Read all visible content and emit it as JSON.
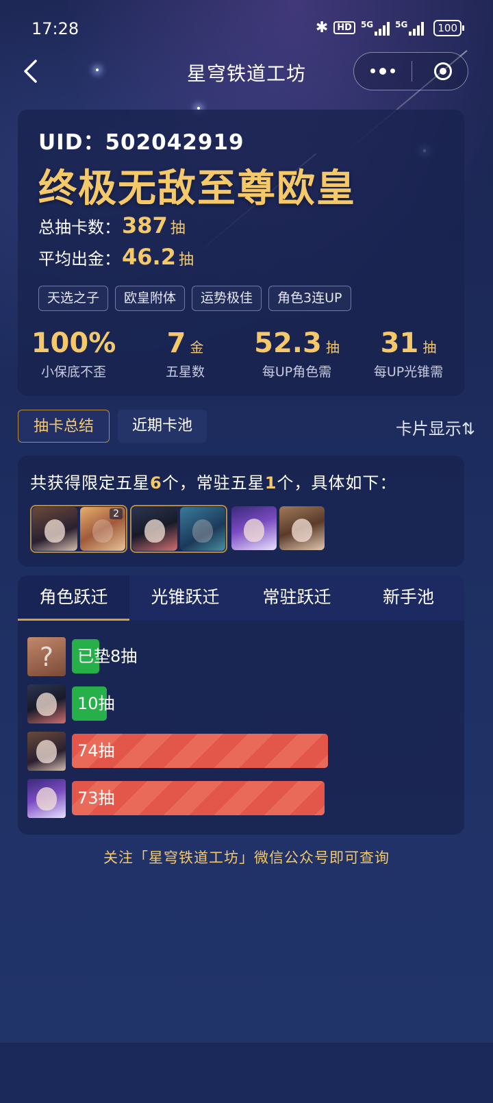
{
  "status_bar": {
    "time": "17:28",
    "hd_label": "HD",
    "network1": "5G",
    "network2": "5G",
    "battery": "100"
  },
  "nav": {
    "title": "星穹铁道工坊"
  },
  "summary": {
    "uid_label": "UID：",
    "uid_value": "502042919",
    "rank_title": "终极无敌至尊欧皇",
    "total_label": "总抽卡数：",
    "total_value": "387",
    "total_unit": "抽",
    "avg_label": "平均出金：",
    "avg_value": "46.2",
    "avg_unit": "抽",
    "tags": [
      "天选之子",
      "欧皇附体",
      "运势极佳",
      "角色3连UP"
    ],
    "metrics": [
      {
        "value": "100%",
        "unit": "",
        "label": "小保底不歪"
      },
      {
        "value": "7",
        "unit": "金",
        "label": "五星数"
      },
      {
        "value": "52.3",
        "unit": "抽",
        "label": "每UP角色需"
      },
      {
        "value": "31",
        "unit": "抽",
        "label": "每UP光锥需"
      }
    ]
  },
  "section_tabs": {
    "summary": "抽卡总结",
    "recent": "近期卡池",
    "display_toggle": "卡片显示⇅"
  },
  "obtained": {
    "prefix": "共获得限定五星",
    "limited_count": "6",
    "middle": "个，常驻五星",
    "standard_count": "1",
    "suffix": "个，具体如下：",
    "badge_count": "2"
  },
  "jump_tabs": [
    "角色跃迁",
    "光锥跃迁",
    "常驻跃迁",
    "新手池"
  ],
  "pulls": [
    {
      "label": "已垫8抽",
      "count": 8,
      "color": "green",
      "avatar": "unknown",
      "avatar_glyph": "?"
    },
    {
      "label": "10抽",
      "count": 10,
      "color": "green",
      "avatar": "character"
    },
    {
      "label": "74抽",
      "count": 74,
      "color": "red",
      "avatar": "character"
    },
    {
      "label": "73抽",
      "count": 73,
      "color": "red",
      "avatar": "character"
    }
  ],
  "footer": {
    "note": "关注「星穹铁道工坊」微信公众号即可查询"
  },
  "colors": {
    "gold": "#f5c96a",
    "green_bar": "#27b04a",
    "red_bar": "#e2574a",
    "card_bg": "#18224e"
  }
}
